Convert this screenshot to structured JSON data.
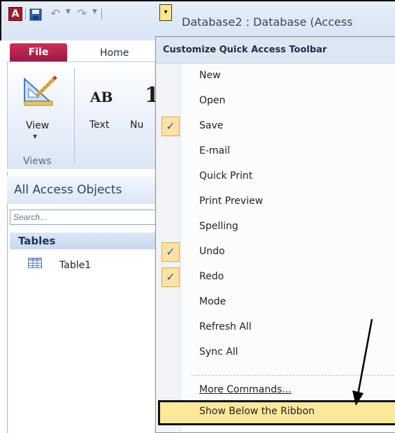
{
  "titlebar": {
    "app_icon_letter": "A",
    "window_title": "Database2 : Database (Access"
  },
  "tabs": [
    {
      "label": "File"
    },
    {
      "label": "Home"
    }
  ],
  "ribbon": {
    "view_label": "View",
    "views_group": "Views",
    "text_glyph": "AB",
    "num_glyph": "1",
    "text_label": "Text",
    "num_label": "Nu"
  },
  "navpane": {
    "header": "All Access Objects",
    "search_placeholder": "Search...",
    "tables_header": "Tables",
    "items": [
      {
        "label": "Table1"
      }
    ]
  },
  "menu": {
    "header": "Customize Quick Access Toolbar",
    "items": [
      {
        "label": "New",
        "checked": false
      },
      {
        "label": "Open",
        "checked": false
      },
      {
        "label": "Save",
        "checked": true
      },
      {
        "label": "E-mail",
        "checked": false
      },
      {
        "label": "Quick Print",
        "checked": false
      },
      {
        "label": "Print Preview",
        "checked": false
      },
      {
        "label": "Spelling",
        "checked": false
      },
      {
        "label": "Undo",
        "checked": true
      },
      {
        "label": "Redo",
        "checked": true
      },
      {
        "label": "Mode",
        "checked": false
      },
      {
        "label": "Refresh All",
        "checked": false
      },
      {
        "label": "Sync All",
        "checked": false
      },
      {
        "label": "More Commands...",
        "checked": false
      },
      {
        "label": "Show Below the Ribbon",
        "checked": false
      }
    ],
    "check_glyph": "✓"
  },
  "colors": {
    "file_tab": "#a0183f",
    "highlight": "#fde89a",
    "check_bg": "#fde3a4"
  }
}
